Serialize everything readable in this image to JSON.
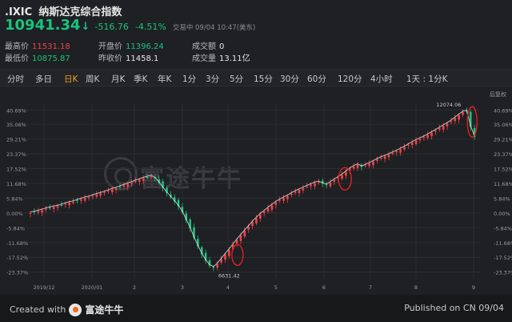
{
  "header": {
    "code": ".IXIC",
    "name": "纳斯达克综合指数",
    "price": "10941.34",
    "arrow": "↓",
    "change": "-516.76",
    "change_pct": "-4.51%",
    "time_info": "交易中 09/04 10:47(美东)",
    "price_color": "#19c37d"
  },
  "stats": {
    "high_label": "最高价",
    "high_value": "11531.18",
    "low_label": "最低价",
    "low_value": "10875.87",
    "open_label": "开盘价",
    "open_value": "11396.24",
    "prev_label": "昨收价",
    "prev_value": "11458.1",
    "amount_label": "成交额",
    "amount_value": "0",
    "volume_label": "成交量",
    "volume_value": "13.11亿"
  },
  "tabs": [
    {
      "label": "分时"
    },
    {
      "label": "多日"
    },
    {
      "label": "日K"
    },
    {
      "label": "周K"
    },
    {
      "label": "月K"
    },
    {
      "label": "季K"
    },
    {
      "label": "年K"
    },
    {
      "label": "1分"
    },
    {
      "label": "3分"
    },
    {
      "label": "5分"
    },
    {
      "label": "15分"
    },
    {
      "label": "30分"
    },
    {
      "label": "60分"
    },
    {
      "label": "120分"
    },
    {
      "label": "4小时"
    },
    {
      "label": "1天 : 1分K"
    }
  ],
  "active_tab": "日K",
  "chart_labels": {
    "top_right": "后复权",
    "max_label": "12074.06",
    "min_label": "6631.42",
    "watermark": "富途牛牛"
  },
  "chart_data": {
    "type": "candlestick",
    "y_ticks": [
      "40.69%",
      "35.06%",
      "29.21%",
      "23.37%",
      "17.52%",
      "11.68%",
      "5.84%",
      "0.00%",
      "-5.84%",
      "-11.68%",
      "-17.52%",
      "-23.37%"
    ],
    "x_ticks": [
      "2019/12",
      "2020/01",
      "2",
      "3",
      "4",
      "5",
      "6",
      "7",
      "8",
      "9"
    ],
    "ylim": [
      -26,
      43
    ],
    "close_pct": [
      0,
      0.3,
      0.7,
      1.1,
      1.6,
      2.0,
      2.4,
      2.6,
      3.1,
      3.6,
      4.0,
      4.4,
      4.9,
      5.4,
      5.9,
      6.2,
      6.8,
      7.3,
      7.7,
      8.2,
      8.7,
      9.3,
      9.8,
      10.3,
      10.9,
      11.4,
      12.0,
      12.6,
      13.1,
      13.7,
      14.1,
      14.5,
      13.6,
      11.9,
      9.8,
      7.9,
      6.2,
      4.5,
      2.6,
      0.3,
      -2.9,
      -6.1,
      -9.8,
      -13.2,
      -16.3,
      -18.9,
      -20.8,
      -21.6,
      -20.2,
      -18.3,
      -16.4,
      -14.6,
      -12.6,
      -10.7,
      -8.9,
      -7.1,
      -5.4,
      -3.6,
      -2.1,
      -0.6,
      0.6,
      1.9,
      3.0,
      4.2,
      5.1,
      5.9,
      6.7,
      7.6,
      8.4,
      9.1,
      9.8,
      10.5,
      11.2,
      11.8,
      12.2,
      11.5,
      11.0,
      12.0,
      13.0,
      14.0,
      15.0,
      16.2,
      17.4,
      18.3,
      19.0,
      18.2,
      18.8,
      19.5,
      20.3,
      21.1,
      21.8,
      22.4,
      23.0,
      23.7,
      24.4,
      25.2,
      26.0,
      26.9,
      27.8,
      28.6,
      29.3,
      30.0,
      30.8,
      31.7,
      32.6,
      33.5,
      34.4,
      35.3,
      36.3,
      37.5,
      38.7,
      39.8,
      40.2,
      34.0,
      30.0
    ],
    "annotations": [
      "min-circle",
      "mid-circle",
      "end-circle"
    ],
    "up_color": "#f2424a",
    "down_color": "#19c37d",
    "ma_color": "#e8e8e8",
    "highlight_color": "#e02020"
  },
  "footer": {
    "created": "Created with",
    "brand": "富途牛牛",
    "published": "Published on CN 09/04"
  }
}
